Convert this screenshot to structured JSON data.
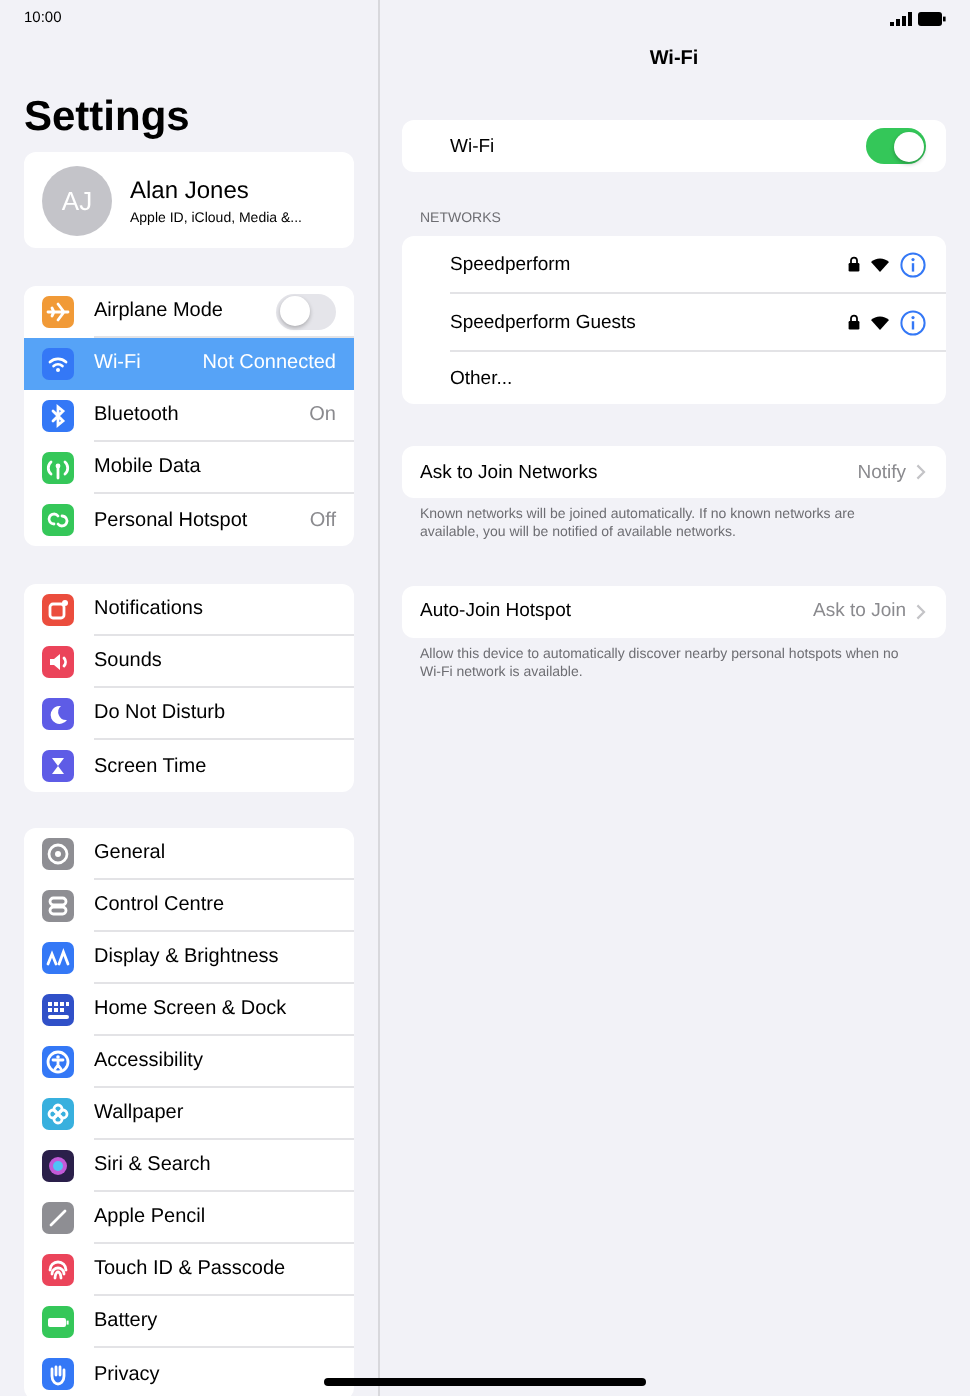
{
  "status_bar": {
    "time": "10:00"
  },
  "sidebar": {
    "title": "Settings",
    "profile": {
      "initials": "AJ",
      "name": "Alan Jones",
      "subtitle": "Apple ID, iCloud, Media &..."
    },
    "groups": [
      {
        "items": [
          {
            "label": "Airplane Mode",
            "kind": "toggle",
            "on": false,
            "selected": false
          },
          {
            "label": "Wi-Fi",
            "kind": "value",
            "value": "Not Connected",
            "selected": true
          },
          {
            "label": "Bluetooth",
            "kind": "value",
            "value": "On",
            "selected": false
          },
          {
            "label": "Mobile Data",
            "kind": "plain",
            "selected": false
          },
          {
            "label": "Personal Hotspot",
            "kind": "value",
            "value": "Off",
            "selected": false
          }
        ]
      },
      {
        "items": [
          {
            "label": "Notifications",
            "kind": "plain",
            "selected": false
          },
          {
            "label": "Sounds",
            "kind": "plain",
            "selected": false
          },
          {
            "label": "Do Not Disturb",
            "kind": "plain",
            "selected": false
          },
          {
            "label": "Screen Time",
            "kind": "plain",
            "selected": false
          }
        ]
      },
      {
        "items": [
          {
            "label": "General",
            "kind": "plain",
            "selected": false
          },
          {
            "label": "Control Centre",
            "kind": "plain",
            "selected": false
          },
          {
            "label": "Display & Brightness",
            "kind": "plain",
            "selected": false
          },
          {
            "label": "Home Screen & Dock",
            "kind": "plain",
            "selected": false
          },
          {
            "label": "Accessibility",
            "kind": "plain",
            "selected": false
          },
          {
            "label": "Wallpaper",
            "kind": "plain",
            "selected": false
          },
          {
            "label": "Siri & Search",
            "kind": "plain",
            "selected": false
          },
          {
            "label": "Apple Pencil",
            "kind": "plain",
            "selected": false
          },
          {
            "label": "Touch ID & Passcode",
            "kind": "plain",
            "selected": false
          },
          {
            "label": "Battery",
            "kind": "plain",
            "selected": false
          },
          {
            "label": "Privacy",
            "kind": "plain",
            "selected": false
          }
        ]
      }
    ]
  },
  "detail": {
    "title": "Wi-Fi",
    "wifi_switch": {
      "label": "Wi-Fi",
      "on": true
    },
    "networks_header": "NETWORKS",
    "networks": [
      {
        "kind": "network",
        "name": "Speedperform",
        "locked": true
      },
      {
        "kind": "network",
        "name": "Speedperform Guests",
        "locked": true
      },
      {
        "kind": "other",
        "name": "Other..."
      }
    ],
    "settings": [
      {
        "label": "Ask to Join Networks",
        "value": "Notify",
        "footer": "Known networks will be joined automatically. If no known networks are available, you will be notified of available networks."
      },
      {
        "label": "Auto-Join Hotspot",
        "value": "Ask to Join",
        "footer": "Allow this device to automatically discover nearby personal hotspots when no Wi-Fi network is available."
      }
    ]
  }
}
